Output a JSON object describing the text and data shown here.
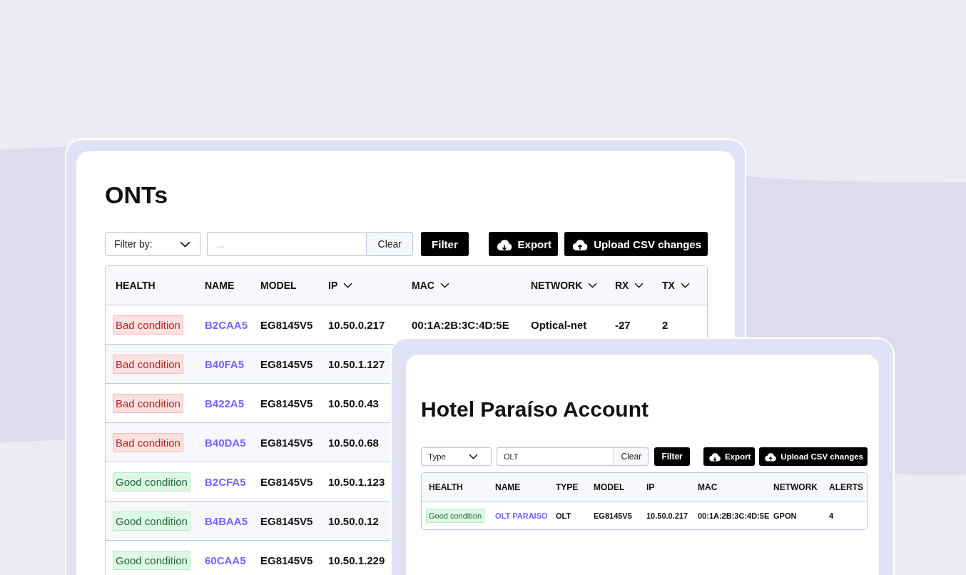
{
  "onts_card": {
    "title": "ONTs",
    "filter": {
      "select": "Filter by:",
      "placeholder": "...",
      "clear": "Clear",
      "submit": "Filter"
    },
    "actions": [
      {
        "label": "Export"
      },
      {
        "label": "Upload CSV changes"
      }
    ],
    "table": {
      "columns": [
        {
          "label": "HEALTH",
          "sortable": false
        },
        {
          "label": "NAME",
          "sortable": false
        },
        {
          "label": "MODEL",
          "sortable": false
        },
        {
          "label": "IP",
          "sortable": true
        },
        {
          "label": "MAC",
          "sortable": true
        },
        {
          "label": "NETWORK",
          "sortable": true
        },
        {
          "label": "RX",
          "sortable": true
        },
        {
          "label": "TX",
          "sortable": true
        }
      ],
      "rows": [
        {
          "kind": "bad",
          "cells": [
            "Bad condition",
            "B2CAA5",
            "EG8145V5",
            "10.50.0.217",
            "00:1A:2B:3C:4D:5E",
            "Optical-net",
            "-27",
            "2"
          ]
        },
        {
          "kind": "bad",
          "cells": [
            "Bad condition",
            "B40FA5",
            "EG8145V5",
            "10.50.1.127"
          ]
        },
        {
          "kind": "bad",
          "cells": [
            "Bad condition",
            "B422A5",
            "EG8145V5",
            "10.50.0.43"
          ]
        },
        {
          "kind": "bad",
          "cells": [
            "Bad condition",
            "B40DA5",
            "EG8145V5",
            "10.50.0.68"
          ]
        },
        {
          "kind": "good",
          "cells": [
            "Good condition",
            "B2CFA5",
            "EG8145V5",
            "10.50.1.123"
          ]
        },
        {
          "kind": "good",
          "cells": [
            "Good condition",
            "B4BAA5",
            "EG8145V5",
            "10.50.0.12"
          ]
        },
        {
          "kind": "good",
          "cells": [
            "Good condition",
            "60CAA5",
            "EG8145V5",
            "10.50.1.229"
          ]
        }
      ]
    }
  },
  "account_card": {
    "title": "Hotel Paraíso Account",
    "filter": {
      "select": "Type",
      "value": "OLT",
      "clear": "Clear",
      "submit": "Filter"
    },
    "actions": [
      {
        "label": "Export"
      },
      {
        "label": "Upload CSV changes"
      }
    ],
    "table": {
      "columns": [
        {
          "label": "HEALTH"
        },
        {
          "label": "NAME"
        },
        {
          "label": "TYPE"
        },
        {
          "label": "MODEL"
        },
        {
          "label": "IP"
        },
        {
          "label": "MAC"
        },
        {
          "label": "NETWORK"
        },
        {
          "label": "ALERTS"
        }
      ],
      "rows": [
        {
          "kind": "good",
          "cells": [
            "Good condition",
            "OLT PARAISO",
            "OLT",
            "EG8145V5",
            "10.50.0.217",
            "00:1A:2B:3C:4D:5E",
            "GPON",
            "4"
          ]
        }
      ]
    }
  }
}
